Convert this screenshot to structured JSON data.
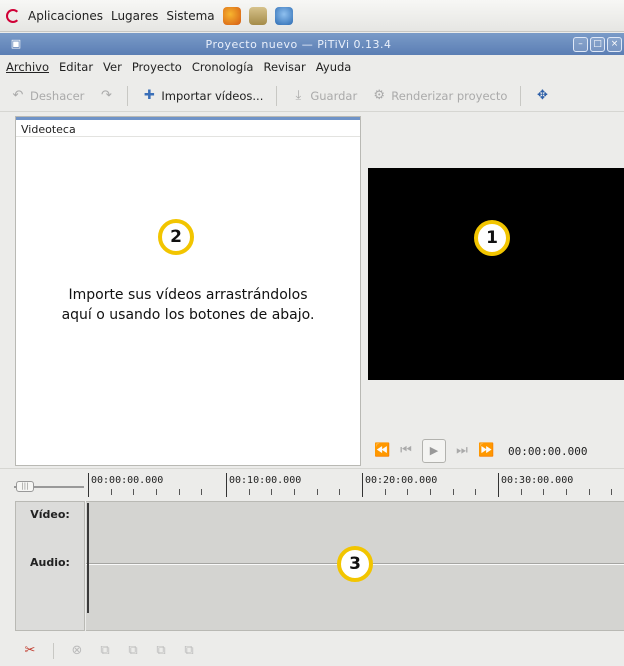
{
  "topbar": {
    "menus": [
      "Aplicaciones",
      "Lugares",
      "Sistema"
    ],
    "icons": [
      "debian-swirl-icon",
      "firefox-icon",
      "home-folder-icon",
      "thunderbird-icon"
    ]
  },
  "window": {
    "title": "Proyecto nuevo — PiTiVi 0.13.4",
    "controls": [
      "minimize-icon",
      "maximize-icon",
      "close-icon"
    ]
  },
  "menubar": {
    "items": [
      "Archivo",
      "Editar",
      "Ver",
      "Proyecto",
      "Cronología",
      "Revisar",
      "Ayuda"
    ]
  },
  "toolbar": {
    "undo_label": "Deshacer",
    "import_label": "Importar vídeos...",
    "save_label": "Guardar",
    "render_label": "Renderizar proyecto"
  },
  "library": {
    "title": "Videoteca",
    "message_line1": "Importe sus vídeos arrastrándolos",
    "message_line2": "aquí o usando los botones de abajo."
  },
  "viewer": {
    "timecode": "00:00:00.000"
  },
  "timeline": {
    "ruler_labels": [
      "00:00:00.000",
      "00:10:00.000",
      "00:20:00.000",
      "00:30:00.000"
    ],
    "tracks": [
      "Vídeo:",
      "Audio:"
    ]
  },
  "callouts": [
    "1",
    "2",
    "3"
  ]
}
